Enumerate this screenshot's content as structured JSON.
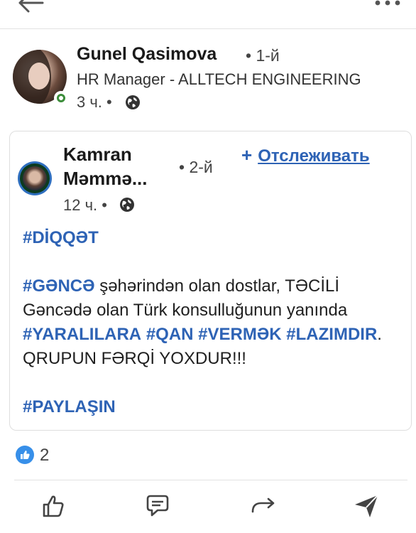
{
  "author": {
    "name": "Gunel Qasimova",
    "degree": "• 1-й",
    "headline": "HR Manager - ALLTECH ENGINEERING",
    "time": "3 ч. •"
  },
  "shared": {
    "name": "Kamran Məmmə...",
    "degree": "• 2-й",
    "follow_plus": "+",
    "follow_label": "Отслеживать",
    "time": "12 ч. •"
  },
  "post": {
    "tag_diqqet": "#DİQQƏT",
    "tag_gence": "#GƏNCƏ",
    "text_1": " şəhərindən olan dostlar, TƏCİLİ Gəncədə olan Türk konsulluğunun yanında ",
    "tag_yaralilara": "#YARALILARA",
    "tag_qan": "#QAN",
    "tag_vermek": "#VERMƏK",
    "tag_lazimdir": "#LAZIMDIR",
    "text_2": ". QRUPUN FƏRQİ YOXDUR!!!",
    "tag_paylasin": "#PAYLAŞIN"
  },
  "reactions": {
    "count": "2"
  },
  "icons": {
    "back": "back-arrow-icon",
    "more": "more-dots-icon",
    "globe": "globe-icon",
    "like_reaction": "like-reaction-icon",
    "like": "thumbs-up-icon",
    "comment": "comment-icon",
    "repost": "repost-icon",
    "send": "send-icon"
  },
  "colors": {
    "link": "#2e63b5",
    "online": "#3c8d3a",
    "reaction": "#378fe9"
  }
}
